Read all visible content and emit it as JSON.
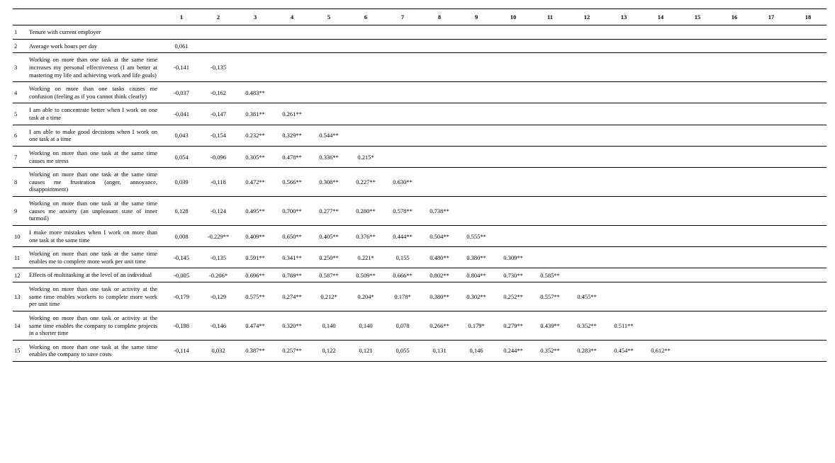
{
  "chart_data": {
    "type": "table",
    "title": "Correlation matrix",
    "columns": [
      "1",
      "2",
      "3",
      "4",
      "5",
      "6",
      "7",
      "8",
      "9",
      "10",
      "11",
      "12",
      "13",
      "14",
      "15",
      "16",
      "17",
      "18"
    ],
    "rows": [
      {
        "n": "1",
        "label": "Tenure with current employer",
        "values": [
          "",
          "",
          "",
          "",
          "",
          "",
          "",
          "",
          "",
          "",
          "",
          "",
          "",
          "",
          "",
          "",
          "",
          ""
        ]
      },
      {
        "n": "2",
        "label": "Average work hours per day",
        "values": [
          "0,061",
          "",
          "",
          "",
          "",
          "",
          "",
          "",
          "",
          "",
          "",
          "",
          "",
          "",
          "",
          "",
          "",
          ""
        ]
      },
      {
        "n": "3",
        "label": "Working on more than one task at the same time increases my personal effectiveness (I am better at mastering my life and achieving work and life goals)",
        "values": [
          "-0,141",
          "-0,135",
          "",
          "",
          "",
          "",
          "",
          "",
          "",
          "",
          "",
          "",
          "",
          "",
          "",
          "",
          "",
          ""
        ]
      },
      {
        "n": "4",
        "label": "Working on more than one tasks causes me confusion (feeling as if you cannot think clearly)",
        "values": [
          "-0,037",
          "-0,162",
          "0.483**",
          "",
          "",
          "",
          "",
          "",
          "",
          "",
          "",
          "",
          "",
          "",
          "",
          "",
          "",
          ""
        ]
      },
      {
        "n": "5",
        "label": "I am able to concentrate better when I work on one task at a time",
        "values": [
          "-0,041",
          "-0,147",
          "0.381**",
          "0.261**",
          "",
          "",
          "",
          "",
          "",
          "",
          "",
          "",
          "",
          "",
          "",
          "",
          "",
          ""
        ]
      },
      {
        "n": "6",
        "label": "I am able to make good decisions when I work on one task at a time",
        "values": [
          "0,043",
          "-0,154",
          "0.232**",
          "0.329**",
          "0.544**",
          "",
          "",
          "",
          "",
          "",
          "",
          "",
          "",
          "",
          "",
          "",
          "",
          ""
        ]
      },
      {
        "n": "7",
        "label": "Working on more than one task at the same time causes me stress",
        "values": [
          "0,054",
          "-0,096",
          "0.305**",
          "0.478**",
          "0.336**",
          "0.215*",
          "",
          "",
          "",
          "",
          "",
          "",
          "",
          "",
          "",
          "",
          "",
          ""
        ]
      },
      {
        "n": "8",
        "label": "Working on more than one task at the same time causes me frustration (anger, annoyance, disappointment)",
        "values": [
          "0,039",
          "-0,118",
          "0.472**",
          "0.566**",
          "0.308**",
          "0.227**",
          "0.630**",
          "",
          "",
          "",
          "",
          "",
          "",
          "",
          "",
          "",
          "",
          ""
        ]
      },
      {
        "n": "9",
        "label": "Working on more than one task at the same time causes me anxiety (an unpleasant state of inner turmoil)",
        "values": [
          "0,128",
          "-0,124",
          "0.495**",
          "0.700**",
          "0.277**",
          "0.280**",
          "0.578**",
          "0.738**",
          "",
          "",
          "",
          "",
          "",
          "",
          "",
          "",
          "",
          ""
        ]
      },
      {
        "n": "10",
        "label": "I make more mistakes when I work on more than one task at the same time",
        "values": [
          "0,008",
          "-0.229**",
          "0.409**",
          "0.650**",
          "0.405**",
          "0.376**",
          "0.444**",
          "0.504**",
          "0.555**",
          "",
          "",
          "",
          "",
          "",
          "",
          "",
          "",
          ""
        ]
      },
      {
        "n": "11",
        "label": "Working on more than one task at the same time enables me to complete more work per unit time",
        "values": [
          "-0,145",
          "-0,135",
          "0.591**",
          "0.341**",
          "0.250**",
          "0.221*",
          "0,155",
          "0.480**",
          "0.380**",
          "0.309**",
          "",
          "",
          "",
          "",
          "",
          "",
          "",
          ""
        ]
      },
      {
        "n": "12",
        "label": "Effects of multitasking at the level of an individual",
        "values": [
          "-0,005",
          "-0.206*",
          "0.696**",
          "0.769**",
          "0.587**",
          "0.509**",
          "0.666**",
          "0.802**",
          "0.804**",
          "0.730**",
          "0.585**",
          "",
          "",
          "",
          "",
          "",
          "",
          ""
        ]
      },
      {
        "n": "13",
        "label": "Working on more than one task or activity at the same time enables workers to complete more work per unit time",
        "values": [
          "-0,179",
          "-0,129",
          "0.575**",
          "0.274**",
          "0.212*",
          "0.204*",
          "0.178*",
          "0.380**",
          "0.302**",
          "0.252**",
          "0.557**",
          "0.455**",
          "",
          "",
          "",
          "",
          "",
          ""
        ]
      },
      {
        "n": "14",
        "label": "Working on more than one task or activity at the same time enables the company to complete projects in a shorter time",
        "values": [
          "-0,198",
          "-0,146",
          "0.474**",
          "0.320**",
          "0,140",
          "0,140",
          "0,078",
          "0.266**",
          "0.179*",
          "0.279**",
          "0.439**",
          "0.352**",
          "0.511**",
          "",
          "",
          "",
          "",
          ""
        ]
      },
      {
        "n": "15",
        "label": "Working on more than one task at the same time enables the company to save costs",
        "values": [
          "-0,114",
          "0,032",
          "0.387**",
          "0.257**",
          "0,122",
          "0,121",
          "0,055",
          "0,131",
          "0,146",
          "0.244**",
          "0.352**",
          "0.283**",
          "0.454**",
          "0.612**",
          "",
          "",
          "",
          ""
        ]
      }
    ]
  }
}
